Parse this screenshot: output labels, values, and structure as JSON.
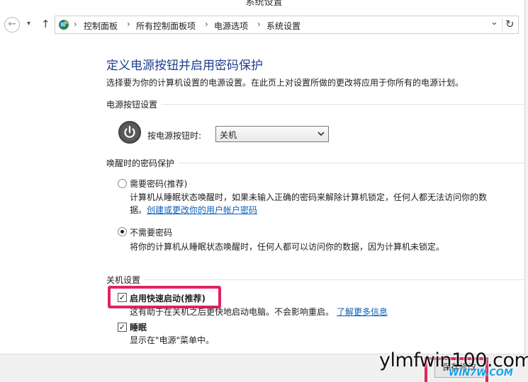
{
  "window": {
    "title": "系统设置"
  },
  "nav": {
    "back_glyph": "←",
    "dropdown_glyph": "▾",
    "up_glyph": "↑",
    "breadcrumbs": [
      "控制面板",
      "所有控制面板项",
      "电源选项",
      "系统设置"
    ],
    "crumb_sep": "›",
    "addr_dropdown_glyph": "⌄",
    "refresh_glyph": "↻"
  },
  "main": {
    "heading": "定义电源按钮并启用密码保护",
    "description": "选择要为你的计算机设置的电源设置。在此页上对设置所做的更改将应用于你所有的电源计划。",
    "power_button_section": {
      "title": "电源按钮设置",
      "label": "按电源按钮时:",
      "selected": "关机"
    },
    "wake_password_section": {
      "title": "唤醒时的密码保护",
      "options": [
        {
          "label": "需要密码(推荐)",
          "desc_line1": "计算机从睡眠状态唤醒时，如果未输入正确的密码来解除计算机锁定，任何人都无法访问你的数",
          "desc_line2_prefix": "据。",
          "link": "创建或更改你的用户帐户密码",
          "selected": false
        },
        {
          "label": "不需要密码",
          "desc_line1": "将你的计算机从睡眠状态唤醒时，任何人都可以访问你的数据，因为计算机未锁定。",
          "selected": true
        }
      ]
    },
    "shutdown_section": {
      "title": "关机设置",
      "items": [
        {
          "label": "启用快速启动(推荐)",
          "desc": "这有助于在关机之后更快地启动电脑。不会影响重启。",
          "link": "了解更多信息",
          "checked": true
        },
        {
          "label": "睡眠",
          "desc": "显示在\"电源\"菜单中。",
          "checked": true
        }
      ]
    }
  },
  "footer": {
    "save_label": "保存修改"
  },
  "watermark": {
    "main": "ylmfwin100.com",
    "sub": "WIN7W.COM"
  },
  "colors": {
    "heading": "#1e3f8f",
    "link": "#0b5fb8",
    "highlight": "#e0245e"
  }
}
